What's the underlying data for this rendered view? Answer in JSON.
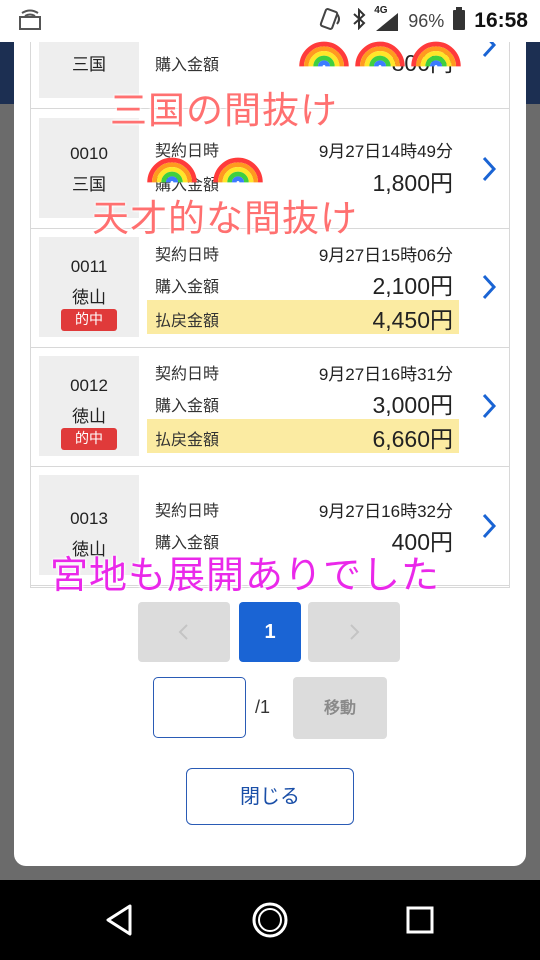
{
  "status_bar": {
    "network": "4G",
    "battery": "96%",
    "time": "16:58"
  },
  "labels": {
    "contract_time": "契約日時",
    "purchase": "購入金額",
    "payout": "払戻金額",
    "hit": "的中"
  },
  "tickets": [
    {
      "id": "",
      "venue": "三国",
      "date": "",
      "purchase": "1,800円",
      "payout": null,
      "hit": false,
      "partial": true,
      "purchase_partial": "800円"
    },
    {
      "id": "0010",
      "venue": "三国",
      "date": "9月27日14時49分",
      "purchase": "1,800円",
      "payout": null,
      "hit": false
    },
    {
      "id": "0011",
      "venue": "徳山",
      "date": "9月27日15時06分",
      "purchase": "2,100円",
      "payout": "4,450円",
      "hit": true
    },
    {
      "id": "0012",
      "venue": "徳山",
      "date": "9月27日16時31分",
      "purchase": "3,000円",
      "payout": "6,660円",
      "hit": true
    },
    {
      "id": "0013",
      "venue": "徳山",
      "date": "9月27日16時32分",
      "purchase": "400円",
      "payout": null,
      "hit": false
    }
  ],
  "pagination": {
    "current_page": "1",
    "total_label": "/1",
    "page_input_value": "",
    "go_label": "移動"
  },
  "close_label": "閉じる",
  "captions": {
    "caption1": "三国の間抜け",
    "caption2": "天才的な間抜け",
    "caption3": "宮地も展開ありでした"
  },
  "colors": {
    "primary": "#1a64d4",
    "hit_badge": "#e03a3a",
    "payout_highlight": "#fbeba2",
    "caption_red": "#ff7070",
    "caption_pink": "#ea28ea"
  }
}
